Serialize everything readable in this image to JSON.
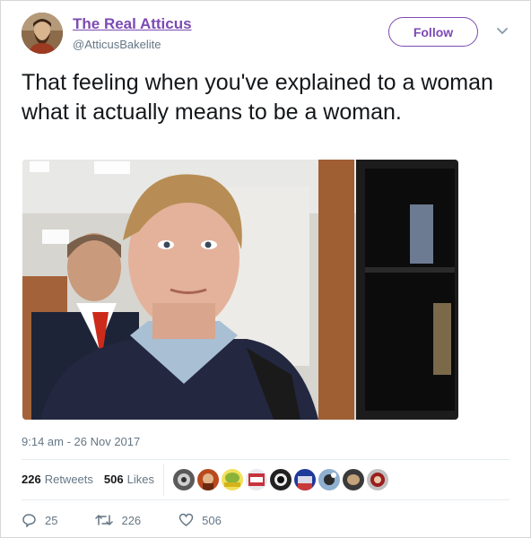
{
  "tweet": {
    "display_name": "The Real Atticus",
    "handle": "@AtticusBakelite",
    "follow_label": "Follow",
    "text": "That feeling when you've explained to a woman what it actually means to be a woman.",
    "timestamp": "9:14 am - 26 Nov 2017",
    "retweets_count": "226",
    "retweets_label": "Retweets",
    "likes_count": "506",
    "likes_label": "Likes",
    "actions": {
      "replies": "25",
      "retweets": "226",
      "likes": "506"
    }
  },
  "colors": {
    "accent": "#7c4ab3",
    "text": "#14171a",
    "muted": "#657786"
  },
  "icons": {
    "caret": "chevron-down-icon",
    "reply": "reply-icon",
    "retweet": "retweet-icon",
    "like": "heart-icon"
  }
}
